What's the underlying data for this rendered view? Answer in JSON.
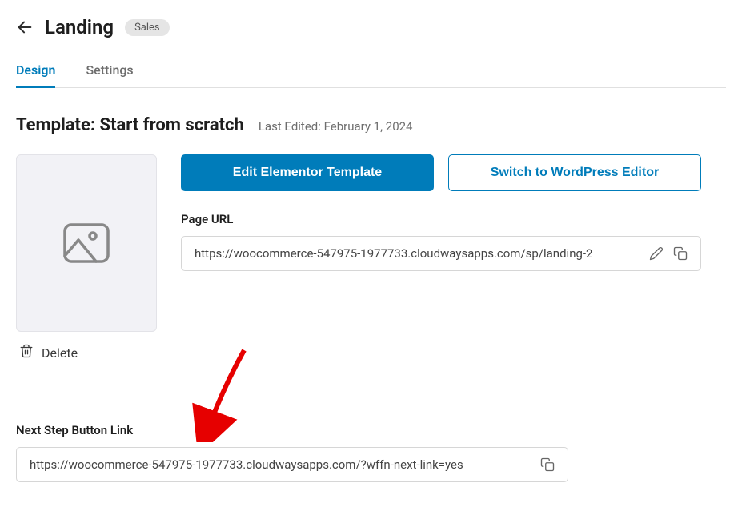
{
  "header": {
    "title": "Landing",
    "badge": "Sales"
  },
  "tabs": {
    "design": "Design",
    "settings": "Settings"
  },
  "template": {
    "title": "Template: Start from scratch",
    "last_edited": "Last Edited: February 1, 2024"
  },
  "actions": {
    "delete": "Delete",
    "edit_elementor": "Edit Elementor Template",
    "switch_wp": "Switch to WordPress Editor"
  },
  "page_url": {
    "label": "Page URL",
    "value": "https://woocommerce-547975-1977733.cloudwaysapps.com/sp/landing-2"
  },
  "next_step": {
    "label": "Next Step Button Link",
    "value": "https://woocommerce-547975-1977733.cloudwaysapps.com/?wffn-next-link=yes"
  }
}
